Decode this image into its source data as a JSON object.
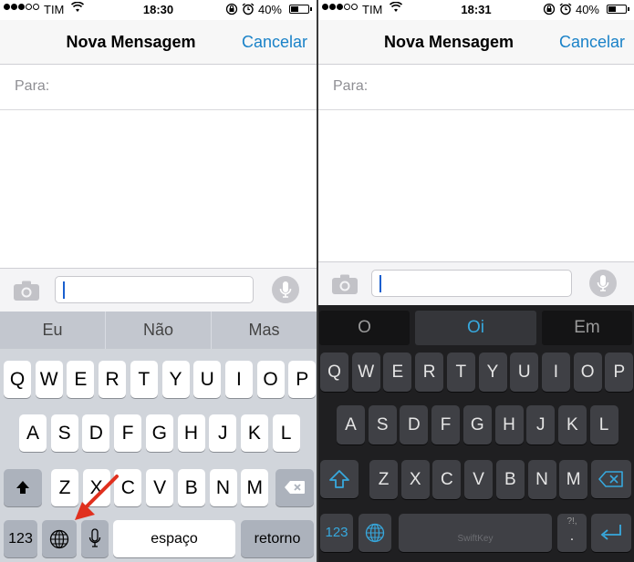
{
  "left": {
    "status": {
      "carrier": "TIM",
      "time": "18:30",
      "battery": "40%"
    },
    "nav": {
      "title": "Nova Mensagem",
      "cancel": "Cancelar"
    },
    "to_label": "Para:",
    "suggestions": [
      "Eu",
      "Não",
      "Mas"
    ],
    "row1": [
      "Q",
      "W",
      "E",
      "R",
      "T",
      "Y",
      "U",
      "I",
      "O",
      "P"
    ],
    "row2": [
      "A",
      "S",
      "D",
      "F",
      "G",
      "H",
      "J",
      "K",
      "L"
    ],
    "row3": [
      "Z",
      "X",
      "C",
      "V",
      "B",
      "N",
      "M"
    ],
    "numbers_label": "123",
    "space_label": "espaço",
    "return_label": "retorno"
  },
  "right": {
    "status": {
      "carrier": "TIM",
      "time": "18:31",
      "battery": "40%"
    },
    "nav": {
      "title": "Nova Mensagem",
      "cancel": "Cancelar"
    },
    "to_label": "Para:",
    "suggestions": [
      "O",
      "Oi",
      "Em"
    ],
    "row1": [
      "Q",
      "W",
      "E",
      "R",
      "T",
      "Y",
      "U",
      "I",
      "O",
      "P"
    ],
    "row2": [
      "A",
      "S",
      "D",
      "F",
      "G",
      "H",
      "J",
      "K",
      "L"
    ],
    "row3": [
      "Z",
      "X",
      "C",
      "V",
      "B",
      "N",
      "M"
    ],
    "numbers_label": "123",
    "space_brand": "SwiftKey",
    "punct_label": "?!,",
    "punct_dot": "."
  },
  "colors": {
    "accent": "#1a82c8",
    "swiftkey_accent": "#37a8dd",
    "annotation_arrow": "#e0301e"
  }
}
